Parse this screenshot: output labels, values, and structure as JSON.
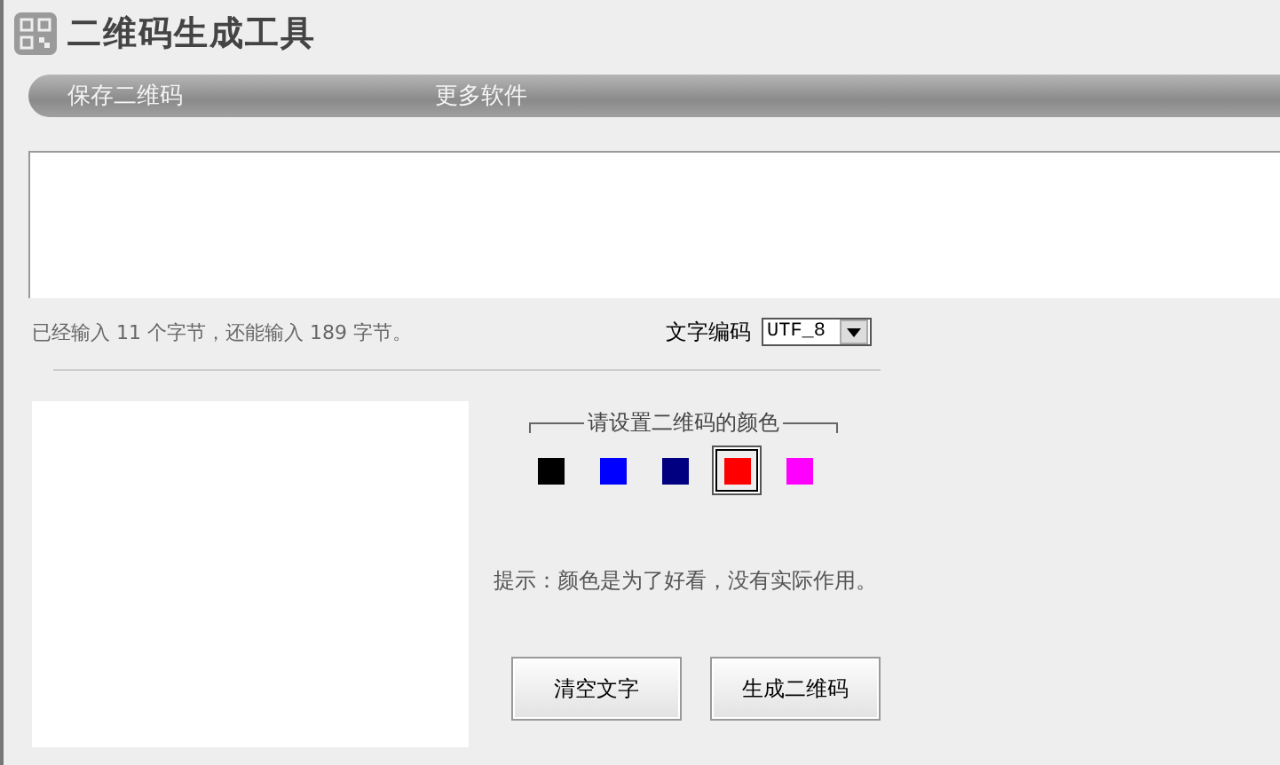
{
  "window": {
    "title": "二维码生成工具"
  },
  "menu": [
    {
      "label": "保存二维码"
    },
    {
      "label": "更多软件"
    }
  ],
  "status": {
    "text": "已经输入 11 个字节，还能输入 189 字节。"
  },
  "encoding": {
    "label": "文字编码",
    "value": "UTF_8"
  },
  "color_panel": {
    "legend": "请设置二维码的颜色",
    "colors": [
      {
        "color": "#000000",
        "selected": false
      },
      {
        "color": "#0000ff",
        "selected": false
      },
      {
        "color": "#000080",
        "selected": false
      },
      {
        "color": "#ff0000",
        "selected": true
      },
      {
        "color": "#ff00ff",
        "selected": false
      }
    ]
  },
  "tip": "提示：颜色是为了好看，没有实际作用。",
  "buttons": [
    {
      "label": "清空文字"
    },
    {
      "label": "生成二维码"
    }
  ]
}
